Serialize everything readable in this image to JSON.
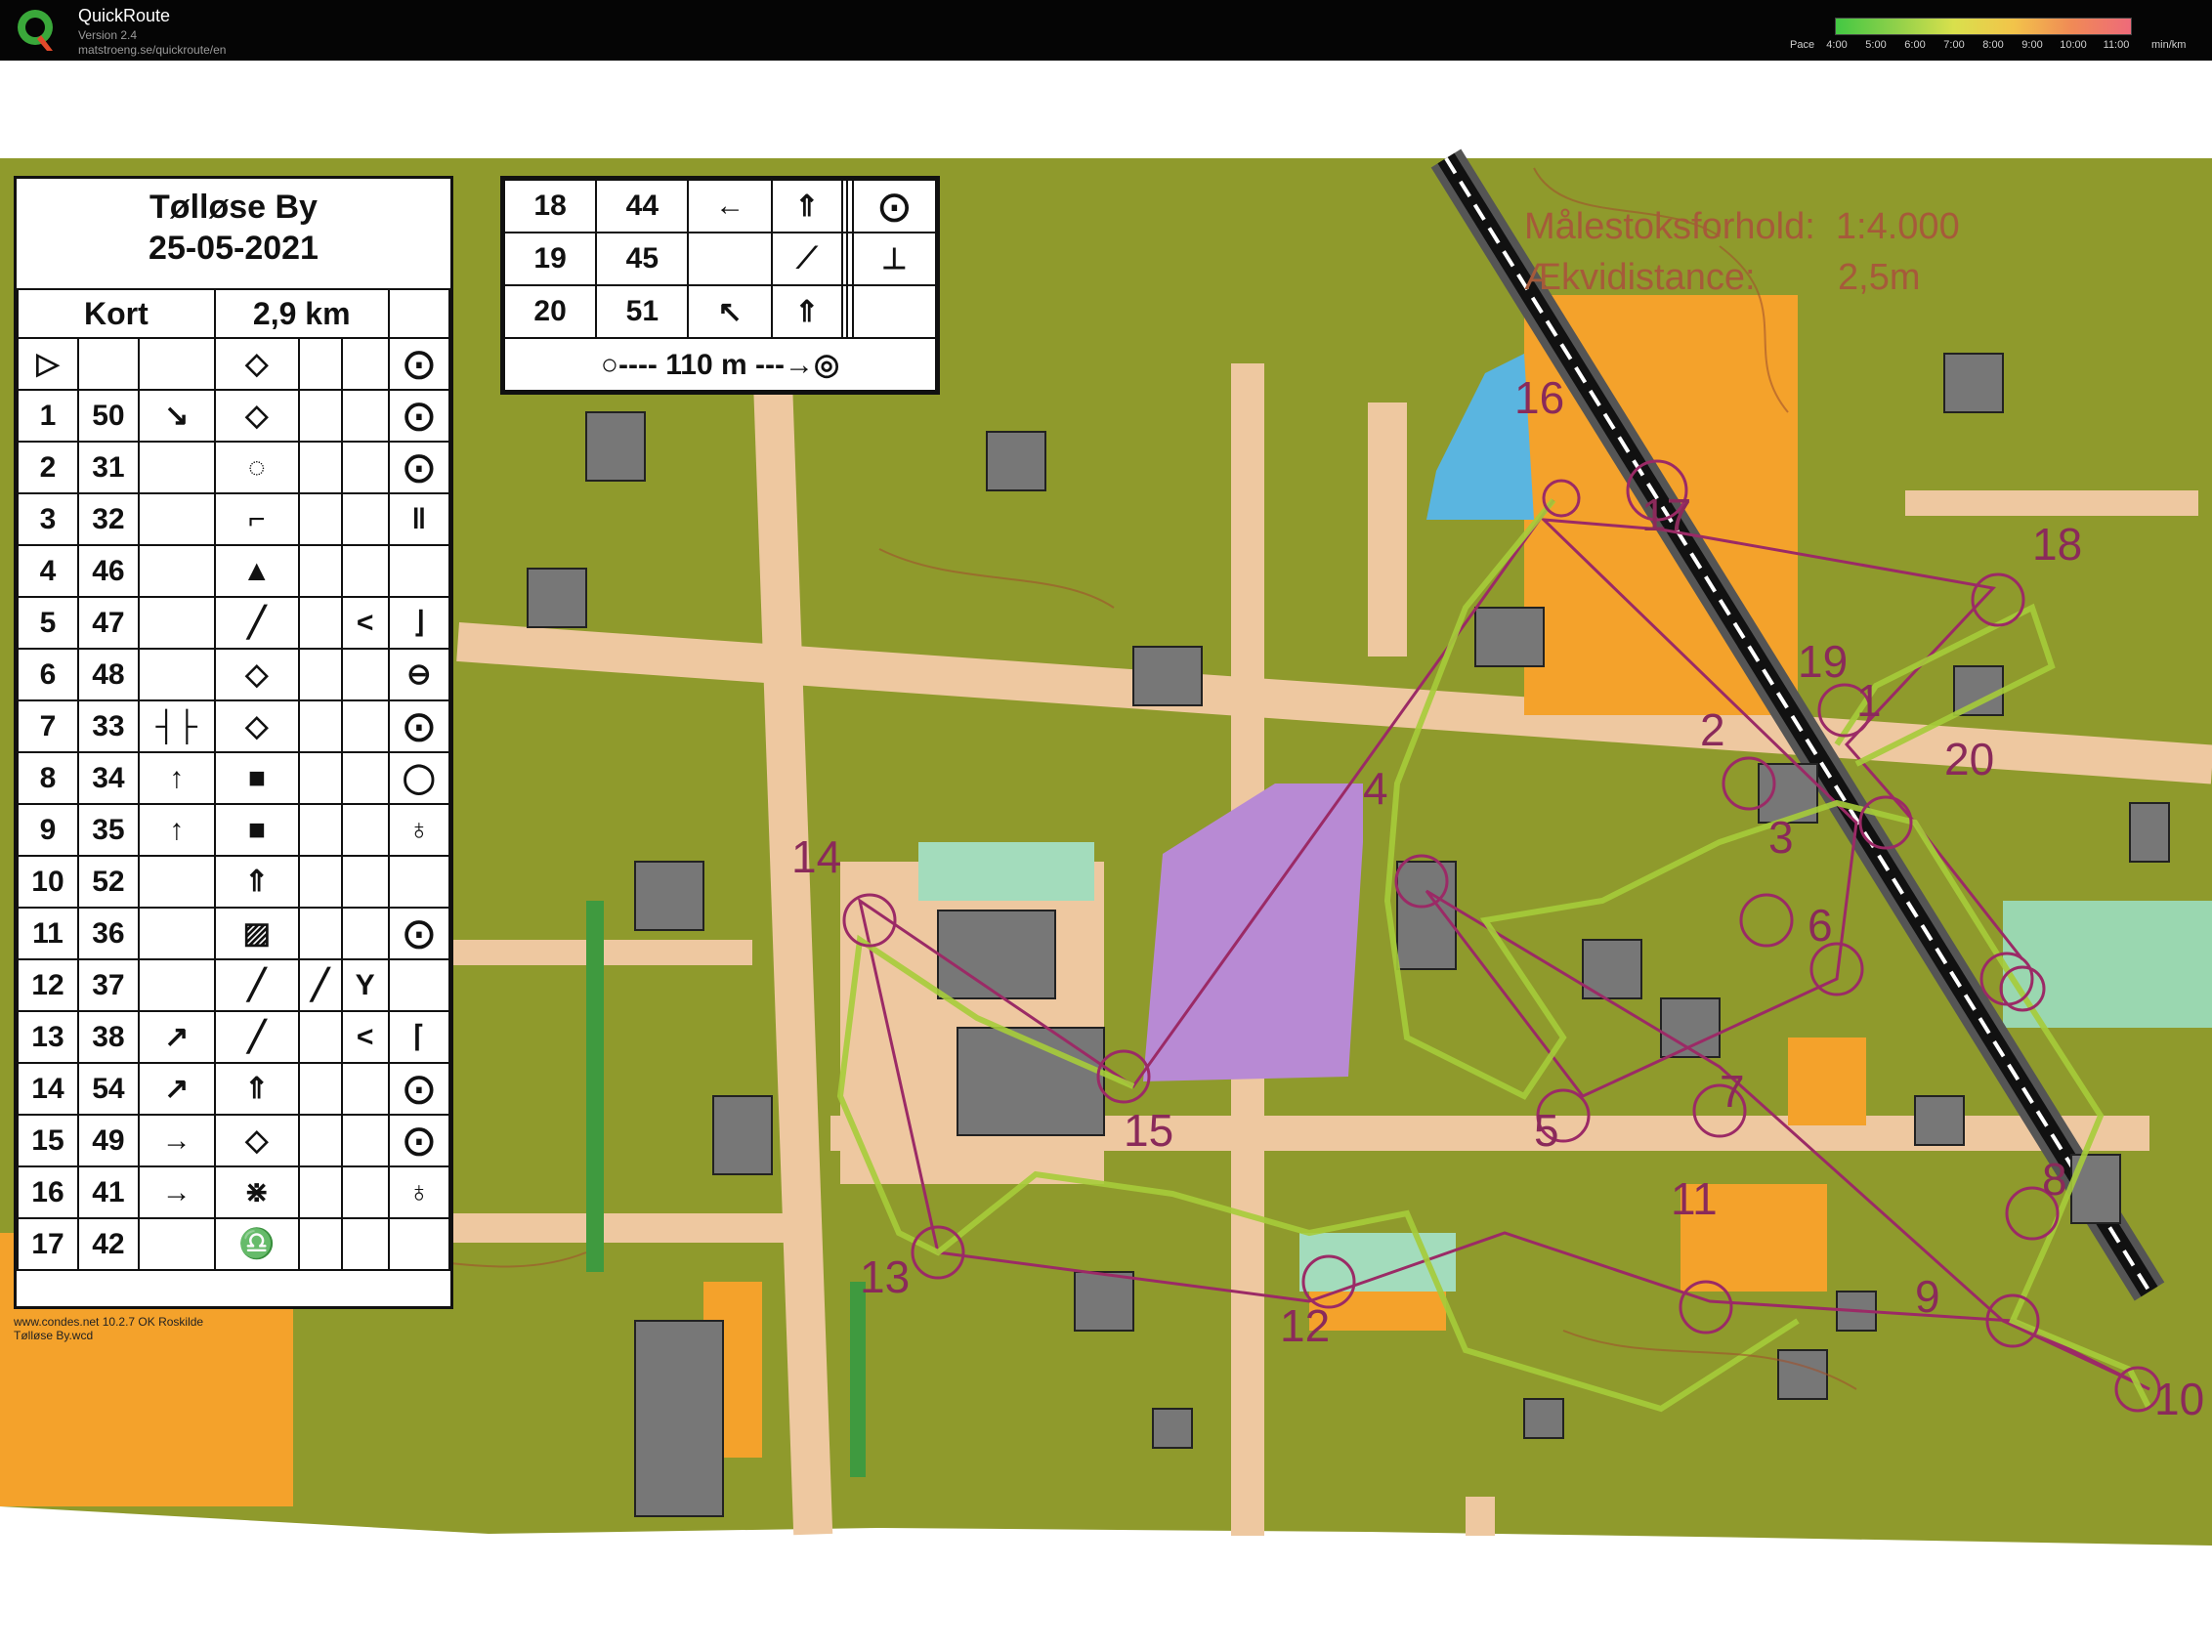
{
  "app": {
    "name": "QuickRoute",
    "version": "Version 2.4",
    "url": "matstroeng.se/quickroute/en"
  },
  "pace": {
    "label": "Pace",
    "ticks": [
      "4:00",
      "5:00",
      "6:00",
      "7:00",
      "8:00",
      "9:00",
      "10:00",
      "11:00"
    ],
    "unit": "min/km",
    "colors": [
      "#43c843",
      "#8ed04a",
      "#d9e04c",
      "#f2c44a",
      "#f08a56",
      "#ee6a7a"
    ]
  },
  "map": {
    "colors": {
      "olive": "#8f9a2c",
      "paved": "#eec8a0",
      "orange": "#f4a22b",
      "green": "#3f9a3f",
      "purple": "#b88ad4",
      "water": "#5ab5e0",
      "building": "#777777",
      "course": "#9b2a66"
    },
    "title": "Tølløse By",
    "date": "25-05-2021",
    "scale_line1": "Målestoksforhold:  1:4.000",
    "scale_line2": "Ækvidistance:        2,5m",
    "credit_line1": "www.condes.net 10.2.7 OK Roskilde",
    "credit_line2": "Tølløse By.wcd",
    "control_numbers": [
      "1",
      "2",
      "3",
      "4",
      "5",
      "6",
      "7",
      "8",
      "9",
      "10",
      "11",
      "12",
      "13",
      "14",
      "15",
      "16",
      "17",
      "18",
      "19",
      "20"
    ]
  },
  "legend": {
    "header": {
      "left": "Kort",
      "right": "2,9 km"
    },
    "start_symbol": "▷",
    "rows": [
      {
        "num": "1",
        "code": "50",
        "dir": "↘",
        "feature": "◇",
        "detail": "",
        "extra": "",
        "where": "⨀"
      },
      {
        "num": "2",
        "code": "31",
        "dir": "",
        "feature": "◌",
        "detail": "",
        "extra": "",
        "where": "⨀"
      },
      {
        "num": "3",
        "code": "32",
        "dir": "",
        "feature": "⌐",
        "detail": "",
        "extra": "",
        "where": "‖"
      },
      {
        "num": "4",
        "code": "46",
        "dir": "",
        "feature": "▲",
        "detail": "",
        "extra": "",
        "where": ""
      },
      {
        "num": "5",
        "code": "47",
        "dir": "",
        "feature": "╱",
        "detail": "",
        "extra": "<",
        "where": "⌋"
      },
      {
        "num": "6",
        "code": "48",
        "dir": "",
        "feature": "◇",
        "detail": "",
        "extra": "",
        "where": "⊖"
      },
      {
        "num": "7",
        "code": "33",
        "dir": "┤├",
        "feature": "◇",
        "detail": "",
        "extra": "",
        "where": "⨀"
      },
      {
        "num": "8",
        "code": "34",
        "dir": "↑",
        "feature": "■",
        "detail": "",
        "extra": "",
        "where": "◯"
      },
      {
        "num": "9",
        "code": "35",
        "dir": "↑",
        "feature": "■",
        "detail": "",
        "extra": "",
        "where": "♁"
      },
      {
        "num": "10",
        "code": "52",
        "dir": "",
        "feature": "⇑",
        "detail": "",
        "extra": "",
        "where": ""
      },
      {
        "num": "11",
        "code": "36",
        "dir": "",
        "feature": "▨",
        "detail": "",
        "extra": "",
        "where": "⨀"
      },
      {
        "num": "12",
        "code": "37",
        "dir": "",
        "feature": "╱",
        "detail": "╱",
        "extra": "Y",
        "where": ""
      },
      {
        "num": "13",
        "code": "38",
        "dir": "↗",
        "feature": "╱",
        "detail": "",
        "extra": "<",
        "where": "⌈"
      },
      {
        "num": "14",
        "code": "54",
        "dir": "↗",
        "feature": "⇑",
        "detail": "",
        "extra": "",
        "where": "⨀"
      },
      {
        "num": "15",
        "code": "49",
        "dir": "→",
        "feature": "◇",
        "detail": "",
        "extra": "",
        "where": "⨀"
      },
      {
        "num": "16",
        "code": "41",
        "dir": "→",
        "feature": "⋇",
        "detail": "",
        "extra": "",
        "where": "♁"
      },
      {
        "num": "17",
        "code": "42",
        "dir": "",
        "feature": "♎",
        "detail": "",
        "extra": "",
        "where": ""
      }
    ]
  },
  "extra_legend": {
    "rows": [
      {
        "num": "18",
        "code": "44",
        "dir": "←",
        "feature": "⇑",
        "detail": "",
        "extra": "",
        "where": "⨀"
      },
      {
        "num": "19",
        "code": "45",
        "dir": "",
        "feature": "⟋",
        "detail": "",
        "extra": "",
        "where": "⊥"
      },
      {
        "num": "20",
        "code": "51",
        "dir": "↖",
        "feature": "⇑",
        "detail": "",
        "extra": "",
        "where": ""
      }
    ],
    "finish": "○---- 110 m ---→◎"
  }
}
